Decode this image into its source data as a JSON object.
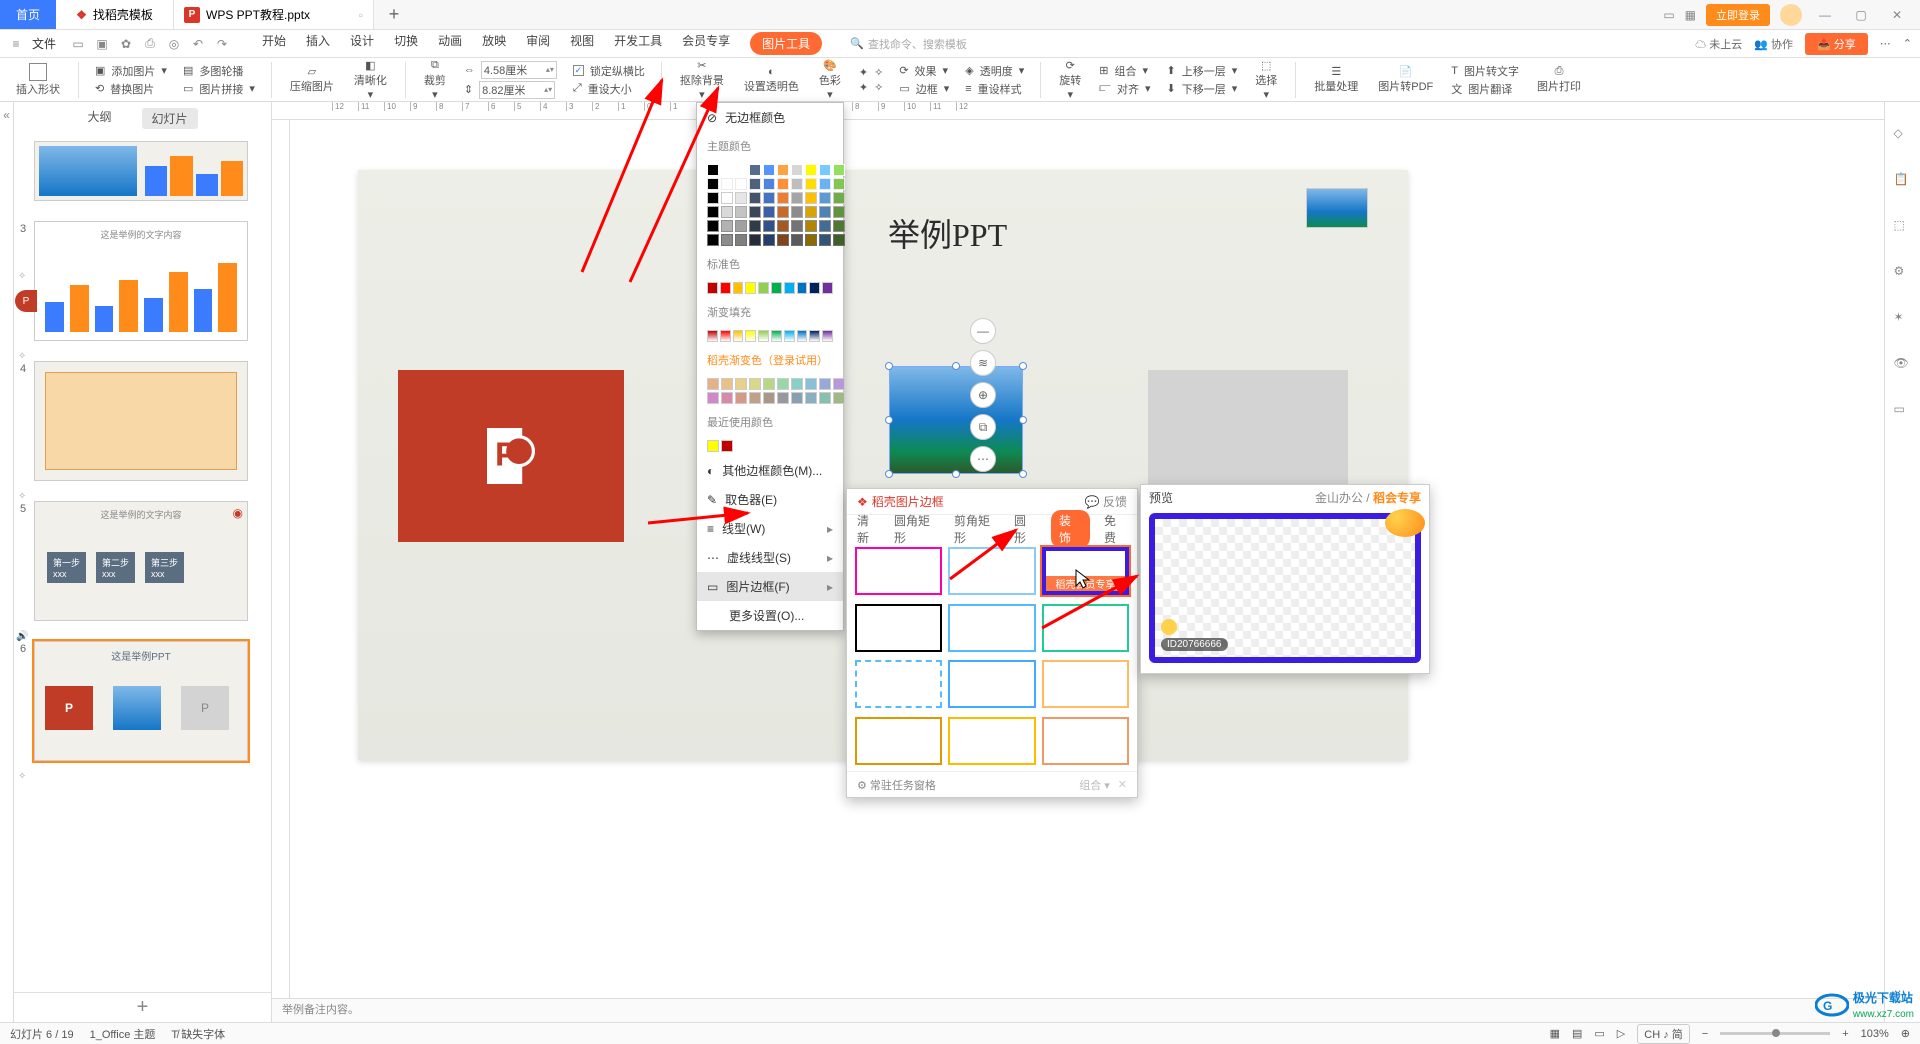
{
  "titlebar": {
    "home": "首页",
    "template": "找稻壳模板",
    "doc": "WPS PPT教程.pptx",
    "login": "立即登录"
  },
  "menubar": {
    "file": "文件",
    "tabs": [
      "开始",
      "插入",
      "设计",
      "切换",
      "动画",
      "放映",
      "审阅",
      "视图",
      "开发工具",
      "会员专享"
    ],
    "img_tools": "图片工具",
    "search_ph": "查找命令、搜索模板",
    "cloud": "未上云",
    "coop": "协作",
    "share": "分享"
  },
  "ribbon": {
    "insert_shape": "插入形状",
    "add_image": "添加图片",
    "multi_outline": "多图轮播",
    "replace_image": "替换图片",
    "image_stitch": "图片拼接",
    "compress": "压缩图片",
    "sharpen": "清晰化",
    "crop": "裁剪",
    "width": "4.58厘米",
    "height": "8.82厘米",
    "lock_ratio": "锁定纵横比",
    "reset_size": "重设大小",
    "remove_bg": "抠除背景",
    "set_transparent": "设置透明色",
    "color": "色彩",
    "effect": "效果",
    "border": "边框",
    "transparency": "透明度",
    "reset_style": "重设样式",
    "rotate": "旋转",
    "combine": "组合",
    "align": "对齐",
    "move_up": "上移一层",
    "move_down": "下移一层",
    "select": "选择",
    "batch": "批量处理",
    "to_pdf": "图片转PDF",
    "to_text": "图片转文字",
    "translate": "图片翻译",
    "print": "图片打印"
  },
  "sidepane": {
    "outline": "大纲",
    "slides": "幻灯片",
    "thumbs": [
      {
        "num": "",
        "type": "split"
      },
      {
        "num": "3",
        "type": "chart"
      },
      {
        "num": "4",
        "type": "mindmap"
      },
      {
        "num": "5",
        "type": "steps"
      },
      {
        "num": "6",
        "type": "current"
      }
    ]
  },
  "slide": {
    "title": "举例PPT",
    "current_title": "这是举例PPT"
  },
  "notes": "举例备注内容。",
  "popup": {
    "no_border": "无边框颜色",
    "theme": "主题颜色",
    "standard": "标准色",
    "gradient": "渐变填充",
    "docker_gradient": "稻壳渐变色（登录试用）",
    "recent": "最近使用颜色",
    "other": "其他边框颜色(M)...",
    "picker": "取色器(E)",
    "line_type": "线型(W)",
    "dash_type": "虚线线型(S)",
    "img_border": "图片边框(F)",
    "more": "更多设置(O)..."
  },
  "frame_panel": {
    "title": "稻壳图片边框",
    "feedback": "反馈",
    "tabs": [
      "清新",
      "圆角矩形",
      "剪角矩形",
      "圆形",
      "装饰",
      "免费"
    ],
    "vip_badge": "稻壳会员专享",
    "pin": "常驻任务窗格",
    "combo": "组合"
  },
  "preview": {
    "title": "预览",
    "org": "金山办公",
    "vip": "稻会专享",
    "id": "ID20766666"
  },
  "status": {
    "slide_count": "幻灯片 6 / 19",
    "theme": "1_Office 主题",
    "missing_font": "缺失字体",
    "ime": "CH ♪ 简",
    "zoom": "103%"
  },
  "watermark": {
    "brand": "极光下载站",
    "url": "www.xz7.com"
  }
}
